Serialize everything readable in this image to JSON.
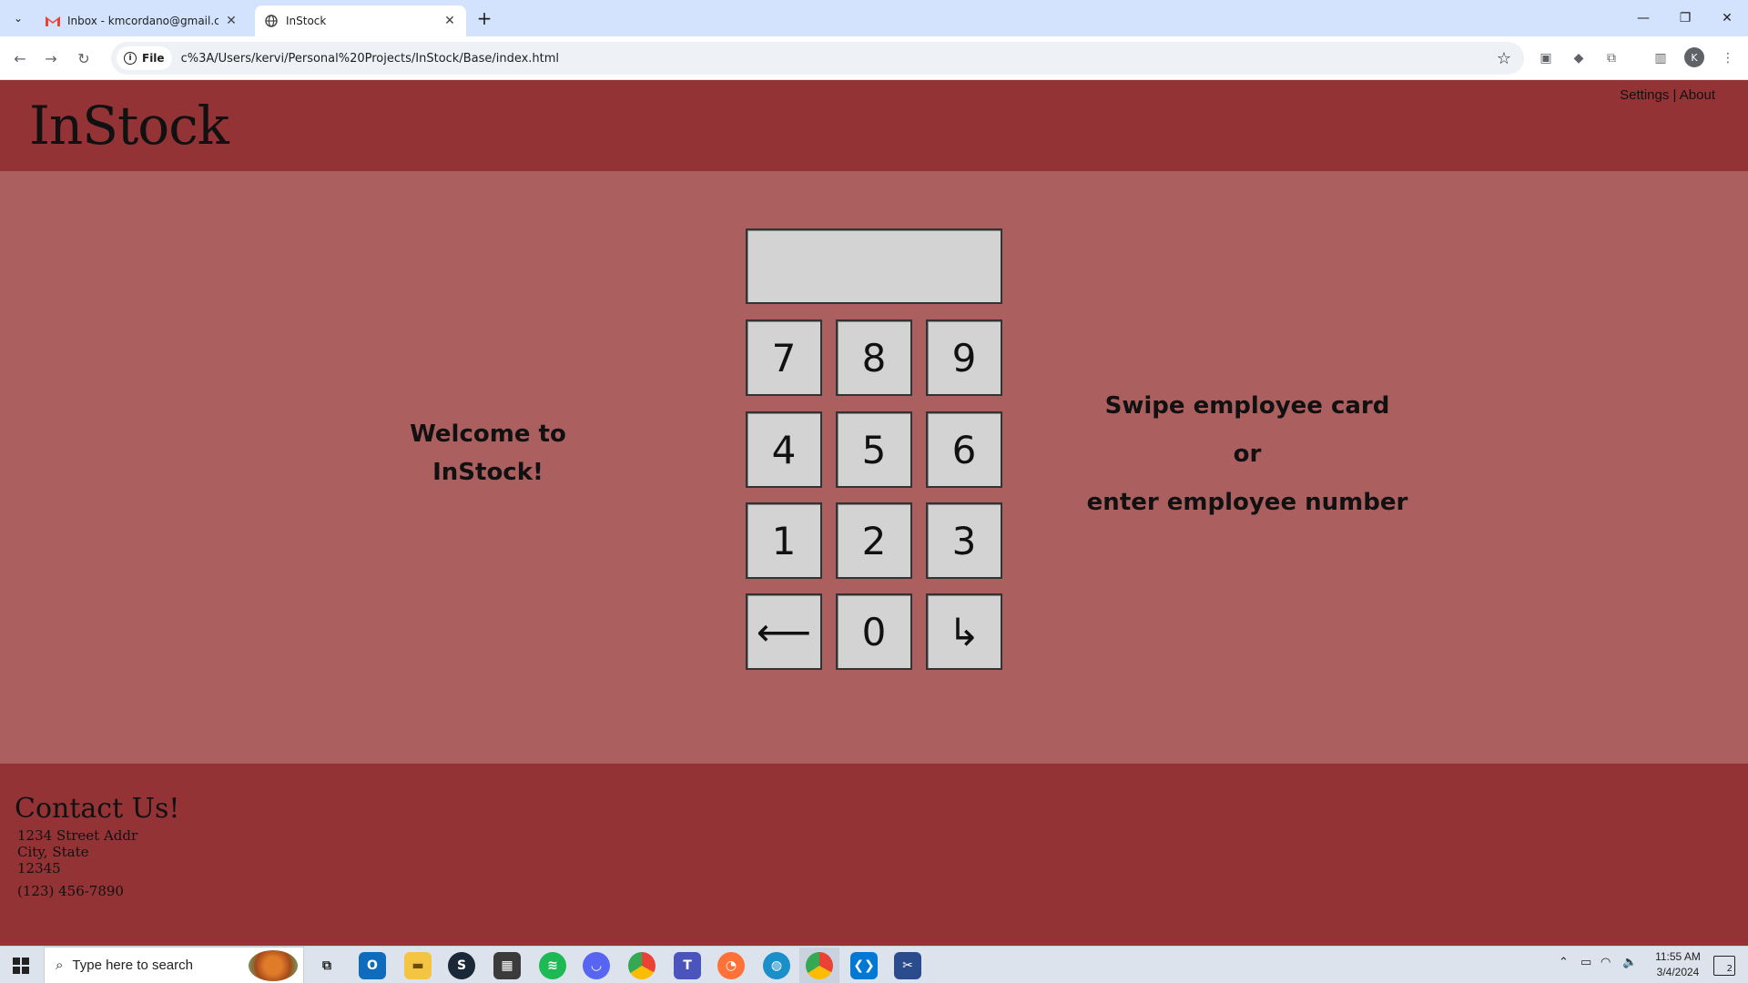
{
  "browser": {
    "tabs": [
      {
        "title": "Inbox - kmcordano@gmail.com",
        "favicon": "gmail-icon",
        "active": false
      },
      {
        "title": "InStock",
        "favicon": "globe-icon",
        "active": true
      }
    ],
    "address": {
      "chip_label": "File",
      "url": "c%3A/Users/kervi/Personal%20Projects/InStock/Base/index.html"
    },
    "profile_initial": "K"
  },
  "page": {
    "logo": "InStock",
    "nav": {
      "settings": "Settings",
      "separator": "|",
      "about": "About"
    },
    "welcome": {
      "line1": "Welcome to",
      "line2": "InStock!"
    },
    "instructions": {
      "line1": "Swipe employee card",
      "line2": "or",
      "line3": "enter employee number"
    },
    "display_value": "",
    "keypad": {
      "k7": "7",
      "k8": "8",
      "k9": "9",
      "k4": "4",
      "k5": "5",
      "k6": "6",
      "k1": "1",
      "k2": "2",
      "k3": "3",
      "backspace": "⟵",
      "k0": "0",
      "enter": "↳"
    },
    "footer": {
      "title": "Contact Us!",
      "address_line1": "1234 Street Addr",
      "address_line2": "City, State",
      "address_line3": "12345",
      "phone": "(123) 456-7890"
    }
  },
  "taskbar": {
    "search_placeholder": "Type here to search",
    "time": "11:55 AM",
    "date": "3/4/2024",
    "notification_count": "2"
  },
  "colors": {
    "header_bg": "#933335",
    "main_bg": "#ac5f5f",
    "key_bg": "#d3d3d3",
    "tabstrip_bg": "#d3e3fd"
  }
}
